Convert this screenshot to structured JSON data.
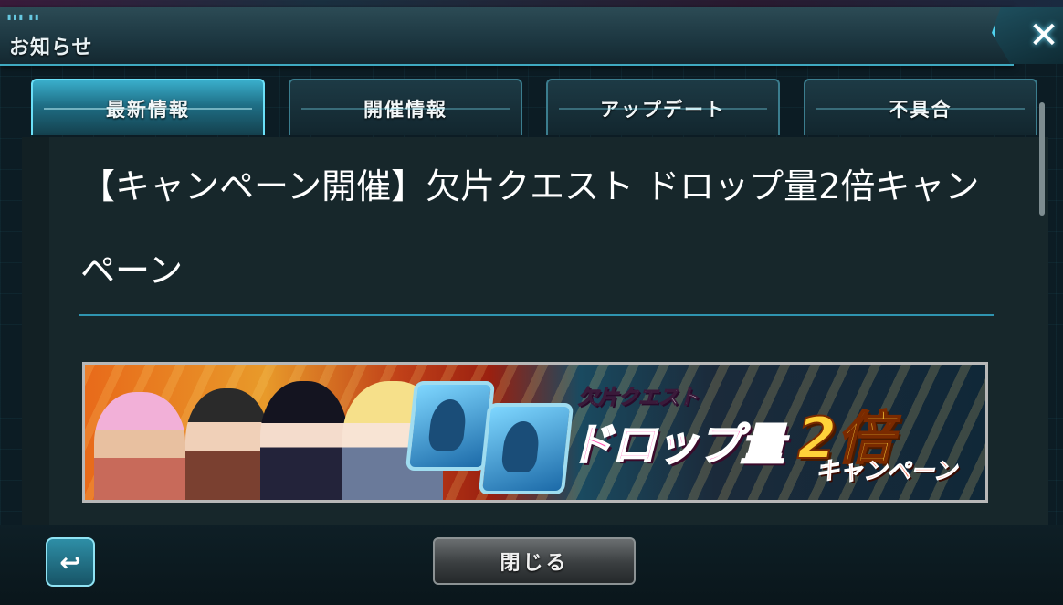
{
  "header": {
    "title": "お知らせ",
    "dots": "▮▮▮ ▮▮"
  },
  "close_icon": "✕",
  "tabs": [
    {
      "label": "最新情報",
      "active": true
    },
    {
      "label": "開催情報",
      "active": false
    },
    {
      "label": "アップデート",
      "active": false
    },
    {
      "label": "不具合",
      "active": false
    }
  ],
  "article": {
    "title": "【キャンペーン開催】欠片クエスト ドロップ量2倍キャンペーン"
  },
  "banner": {
    "line1": "欠片クエスト",
    "line2": "ドロップ量",
    "line3": "2倍",
    "line4": "キャンペーン"
  },
  "footer": {
    "back_icon": "↩",
    "close_label": "閉じる"
  },
  "colors": {
    "accent": "#3fa9c0",
    "active_tab": "#3aaecb",
    "panel": "#17272b"
  }
}
